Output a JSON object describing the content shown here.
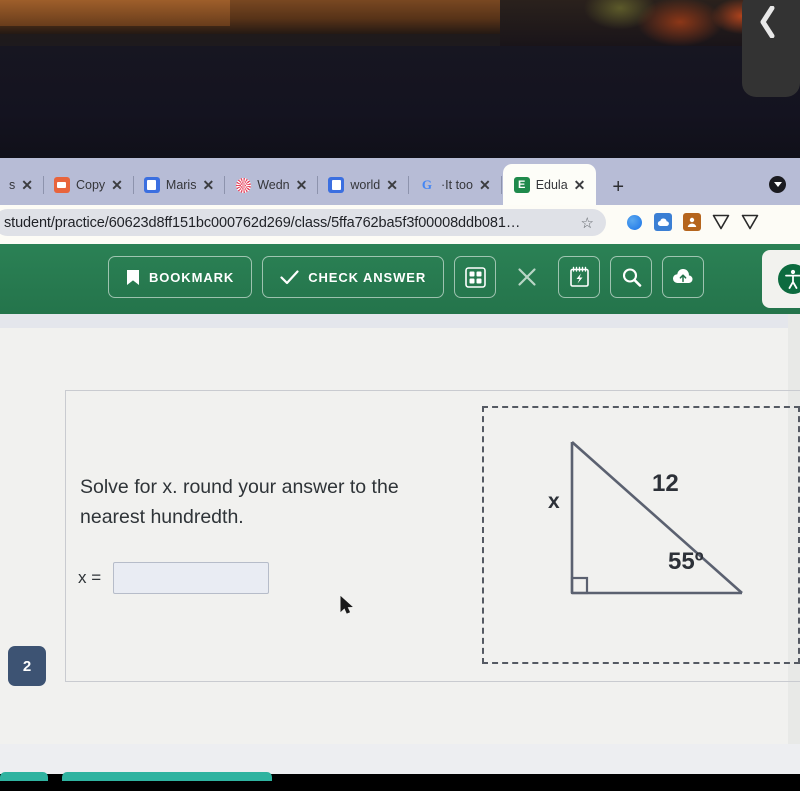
{
  "device": {
    "back_icon": "back-chevron-icon"
  },
  "browser": {
    "tabs": [
      {
        "title": "s",
        "favicon": "generic-favicon",
        "active": false,
        "close": "✕"
      },
      {
        "title": "Copy",
        "favicon": "orange-square-favicon",
        "active": false,
        "close": "✕"
      },
      {
        "title": "Maris",
        "favicon": "google-docs-favicon",
        "active": false,
        "close": "✕"
      },
      {
        "title": "Wedn",
        "favicon": "pinwheel-favicon",
        "active": false,
        "close": "✕"
      },
      {
        "title": "world",
        "favicon": "google-docs-favicon",
        "active": false,
        "close": "✕"
      },
      {
        "title": "·It too",
        "favicon": "google-favicon",
        "active": false,
        "close": "✕"
      },
      {
        "title": "Edula",
        "favicon": "edulastic-favicon",
        "active": true,
        "close": "✕"
      }
    ],
    "new_tab_label": "+",
    "new_tab_icon": "plus-icon",
    "tab_menu_icon": "chevron-down-circle-icon",
    "url": "student/practice/60623d8ff151bc000762d269/class/5ffa762ba5f3f00008ddb081…",
    "bookmark_star_icon": "star-icon",
    "extensions": [
      {
        "name": "blue-circle-extension-icon"
      },
      {
        "name": "cloud-extension-icon"
      },
      {
        "name": "profile-extension-icon"
      },
      {
        "name": "shield-extension-icon"
      },
      {
        "name": "shield-extension-icon-2"
      }
    ]
  },
  "toolbar": {
    "bookmark_label": "BOOKMARK",
    "bookmark_icon": "bookmark-icon",
    "check_answer_label": "CHECK ANSWER",
    "check_answer_icon": "checkmark-icon",
    "grid_icon": "grid-calculator-icon",
    "close_icon": "close-x-icon",
    "notepad_icon": "notepad-icon",
    "magnifier_icon": "magnifier-icon",
    "upload_icon": "cloud-upload-icon",
    "accessibility_icon": "accessibility-icon"
  },
  "question": {
    "number": "2",
    "prompt": "Solve for x. round your answer to the nearest hundredth.",
    "answer_label": "x =",
    "answer_value": "",
    "answer_placeholder": ""
  },
  "figure": {
    "type": "right-triangle-diagram",
    "side_vertical_label": "x",
    "hypotenuse_label": "12",
    "angle_label": "55º",
    "right_angle_marker": "right-angle-square"
  },
  "colors": {
    "toolbar_green": "#24744b",
    "badge_navy": "#3d5373",
    "bottom_teal": "#2fb3a0",
    "tabstrip": "#b7bcd6"
  }
}
